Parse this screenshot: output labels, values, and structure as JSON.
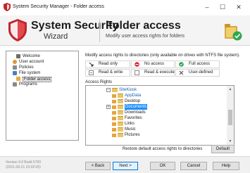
{
  "window": {
    "title": "System Security Manager - Folder access",
    "minimize_glyph": "–",
    "maximize_glyph": "☐",
    "close_glyph": "✕"
  },
  "header": {
    "brand_line1": "System Security",
    "brand_line2": "Wizard",
    "page_title": "Folder access",
    "page_subtitle": "Modify user access rights for folders",
    "icons": [
      "shield-logo-icon",
      "folder-check-icon"
    ]
  },
  "nav": {
    "items": [
      {
        "label": "Welcome",
        "icon": "computer-icon",
        "color": "#6c6c6c"
      },
      {
        "label": "User account",
        "icon": "user-icon",
        "color": "#d89a3c"
      },
      {
        "label": "Policies",
        "icon": "policy-icon",
        "color": "#8a8a8a"
      },
      {
        "label": "File system",
        "icon": "network-icon",
        "color": "#4a7fc1"
      },
      {
        "label": "Folder access",
        "icon": "folder-icon",
        "color": "#e2b13c",
        "selected": true
      },
      {
        "label": "Programs",
        "icon": "programs-icon",
        "color": "#8a8a8a"
      }
    ]
  },
  "info": "Modify access rights to directories (only available on drives with NTFS file system).",
  "options": [
    {
      "label": "Read only",
      "icon": "arrow-icon",
      "color": "#2b2b2b"
    },
    {
      "label": "No access",
      "icon": "no-access-icon",
      "color": "#d9262f"
    },
    {
      "label": "Full access",
      "icon": "check-icon",
      "color": "#1fa24a"
    },
    {
      "label": "Read & write",
      "icon": "read-write-icon",
      "color": "#6c6c6c"
    },
    {
      "label": "Read & execute",
      "icon": "read-execute-icon",
      "color": "#6c6c6c"
    },
    {
      "label": "User-defined",
      "icon": "user-defined-icon",
      "color": "#444444"
    }
  ],
  "access_rights_label": "Access Rights",
  "tree": {
    "root": "SiteKiosk",
    "children": [
      "AppData",
      "Desktop",
      "Documents",
      "Downloads",
      "Favorites",
      "Links",
      "Music",
      "Pictures"
    ],
    "selected": "Documents",
    "expand_glyph": "+",
    "collapse_glyph": "−",
    "scroll_up": "▲",
    "scroll_down": "▼"
  },
  "restore_label": "Restore default access rights to directories",
  "buttons": {
    "default": "Default",
    "back": "< Back",
    "next": "Next >",
    "ok": "OK",
    "cancel": "Cancel",
    "help": "Help"
  },
  "version": {
    "line1": "Version 9.0 Build 5760",
    "line2": "(2021-09-21 23:02:05)"
  },
  "colors": {
    "accent": "#0078d7",
    "selection": "#1e90ff",
    "link_blue": "#1a5fb4",
    "shield_red": "#c0262c"
  }
}
